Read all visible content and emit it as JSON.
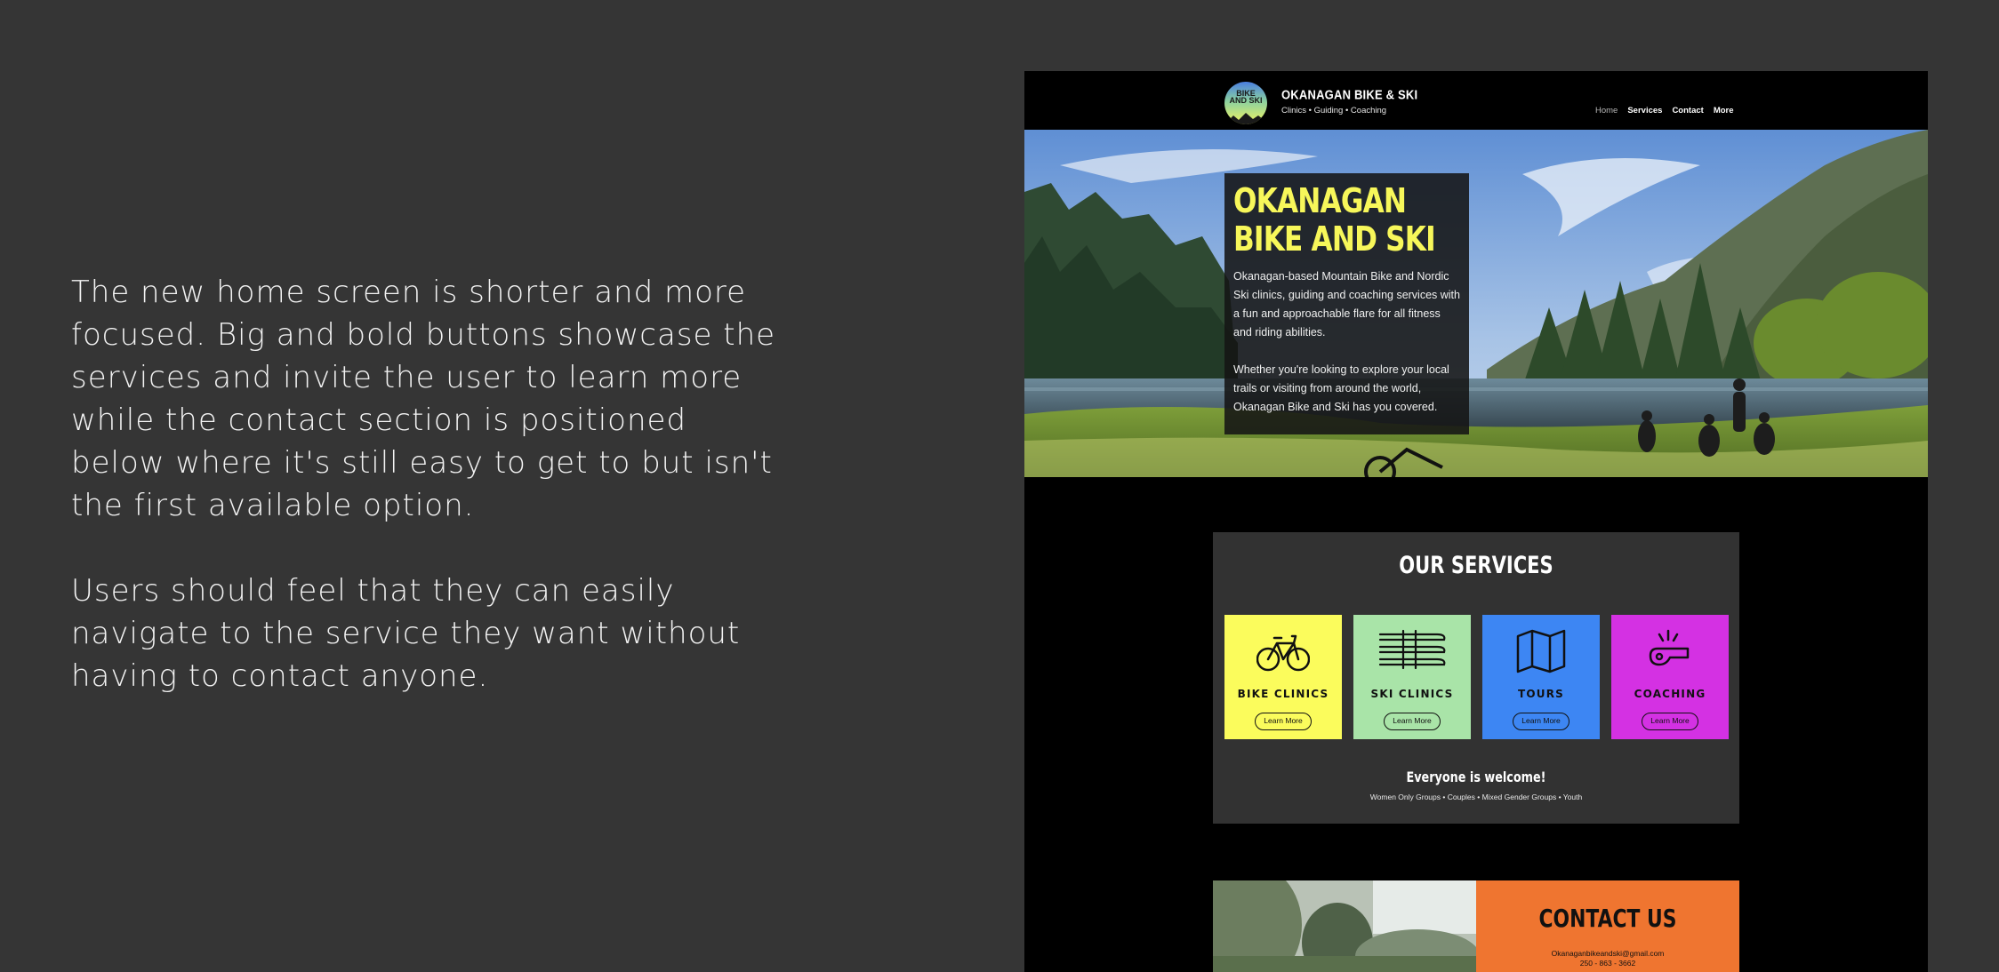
{
  "description": {
    "paragraph_1": "The new home screen is shorter and more focused. Big and bold buttons showcase the services and invite the user to learn more while the contact section is positioned below where it's still easy to get to but isn't the first available option.",
    "paragraph_2": "Users should feel that they can easily navigate to the service they want without having to contact anyone."
  },
  "site": {
    "header": {
      "logo_text_1": "BIKE",
      "logo_text_2": "AND SKI",
      "brand_name": "OKANAGAN BIKE & SKI",
      "tagline": "Clinics • Guiding • Coaching",
      "nav": [
        "Home",
        "Services",
        "Contact",
        "More"
      ],
      "active_nav": "Home"
    },
    "hero": {
      "title": "OKANAGAN\nBIKE AND SKI",
      "text_1": "Okanagan-based Mountain Bike and Nordic Ski clinics, guiding and coaching services with a fun and approachable flare for all fitness and riding abilities.",
      "text_2": "Whether you're looking to explore your local trails or visiting from around the world, Okanagan Bike and Ski has you covered."
    },
    "services": {
      "title": "OUR SERVICES",
      "cards": [
        {
          "label": "BIKE CLINICS",
          "button": "Learn More",
          "icon": "bicycle-icon",
          "color": "#fbfc5c"
        },
        {
          "label": "SKI CLINICS",
          "button": "Learn More",
          "icon": "skis-icon",
          "color": "#a9e4a8"
        },
        {
          "label": "TOURS",
          "button": "Learn More",
          "icon": "map-icon",
          "color": "#3d86f3"
        },
        {
          "label": "COACHING",
          "button": "Learn More",
          "icon": "whistle-icon",
          "color": "#d431e3"
        }
      ],
      "welcome": "Everyone is welcome!",
      "groups": "Women Only Groups • Couples • Mixed Gender Groups • Youth"
    },
    "contact": {
      "title": "CONTACT US",
      "email": "Okanaganbikeandski@gmail.com",
      "phone": "250 - 863 - 3662",
      "color": "#ef7530"
    }
  }
}
